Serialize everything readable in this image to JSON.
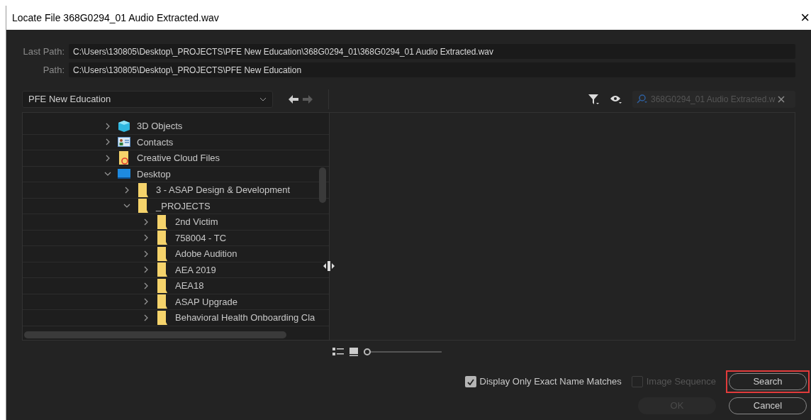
{
  "window": {
    "title": "Locate File 368G0294_01 Audio Extracted.wav",
    "close": "×"
  },
  "last_path": {
    "label": "Last Path:",
    "value": "C:\\Users\\130805\\Desktop\\_PROJECTS\\PFE New Education\\368G0294_01\\368G0294_01 Audio Extracted.wav"
  },
  "path": {
    "label": "Path:",
    "value": "C:\\Users\\130805\\Desktop\\_PROJECTS\\PFE New Education"
  },
  "location_dropdown": {
    "value": "PFE New Education"
  },
  "search_field": {
    "placeholder": "368G0294_01 Audio Extracted.w"
  },
  "tree": [
    {
      "label": "3D Objects",
      "kind": "cube",
      "expanded": false
    },
    {
      "label": "Contacts",
      "kind": "contacts",
      "expanded": false
    },
    {
      "label": "Creative Cloud Files",
      "kind": "cloud",
      "expanded": false
    },
    {
      "label": "Desktop",
      "kind": "desktop",
      "expanded": true,
      "children": [
        {
          "label": "3 - ASAP Design & Development",
          "kind": "folder",
          "expanded": false
        },
        {
          "label": "_PROJECTS",
          "kind": "folder",
          "expanded": true,
          "children": [
            {
              "label": "2nd Victim",
              "kind": "folder",
              "expanded": false
            },
            {
              "label": "758004 - TC",
              "kind": "folder",
              "expanded": false
            },
            {
              "label": "Adobe Audition",
              "kind": "folder",
              "expanded": false
            },
            {
              "label": "AEA 2019",
              "kind": "folder",
              "expanded": false
            },
            {
              "label": "AEA18",
              "kind": "folder",
              "expanded": false
            },
            {
              "label": "ASAP Upgrade",
              "kind": "folder",
              "expanded": false
            },
            {
              "label": "Behavioral Health Onboarding Cla",
              "kind": "folder",
              "expanded": false
            }
          ]
        }
      ]
    }
  ],
  "zoom_slider": {
    "level": 0
  },
  "options": [
    {
      "label": "Display Only Exact Name Matches",
      "checked": true,
      "disabled": false
    },
    {
      "label": "Image Sequence",
      "checked": false,
      "disabled": true
    }
  ],
  "search_button": {
    "label": "Search",
    "highlighted": true,
    "disabled": false
  },
  "buttons": [
    {
      "label": "OK",
      "highlighted": false,
      "disabled": true
    },
    {
      "label": "Cancel",
      "highlighted": false,
      "disabled": false
    }
  ]
}
